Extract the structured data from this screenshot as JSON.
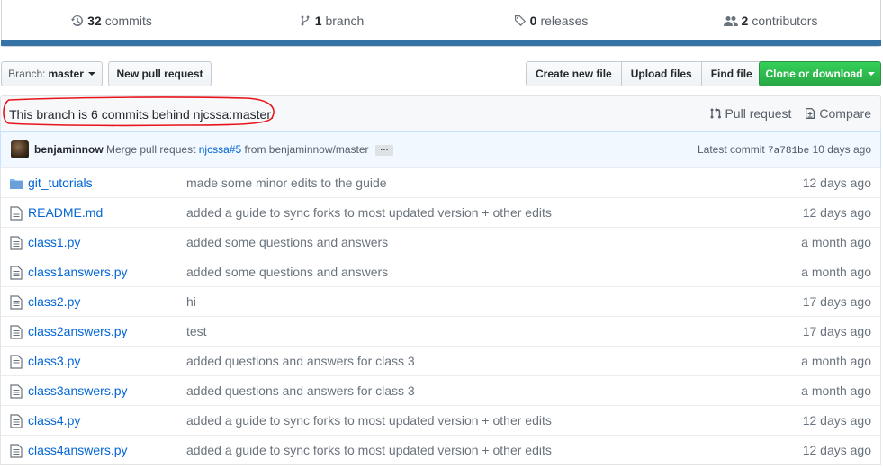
{
  "summary": {
    "commits_count": "32",
    "commits_label": "commits",
    "branches_count": "1",
    "branches_label": "branch",
    "releases_count": "0",
    "releases_label": "releases",
    "contributors_count": "2",
    "contributors_label": "contributors",
    "language_color": "#3572a5"
  },
  "toolbar": {
    "branch_prefix": "Branch:",
    "branch_name": "master",
    "new_pull_request": "New pull request",
    "create_new_file": "Create new file",
    "upload_files": "Upload files",
    "find_file": "Find file",
    "clone_or_download": "Clone or download"
  },
  "branch_info": {
    "message": "This branch is 6 commits behind njcssa:master.",
    "pull_request": "Pull request",
    "compare": "Compare"
  },
  "latest_commit": {
    "author": "benjaminnow",
    "message_prefix": "Merge pull request",
    "pr_link": "njcssa#5",
    "message_suffix": "from benjaminnow/master",
    "ellipsis": "…",
    "label": "Latest commit",
    "sha": "7a781be",
    "age": "10 days ago"
  },
  "files": [
    {
      "name": "git_tutorials",
      "type": "folder",
      "message": "made some minor edits to the guide",
      "age": "12 days ago"
    },
    {
      "name": "README.md",
      "type": "file",
      "message": "added a guide to sync forks to most updated version + other edits",
      "age": "12 days ago"
    },
    {
      "name": "class1.py",
      "type": "file",
      "message": "added some questions and answers",
      "age": "a month ago"
    },
    {
      "name": "class1answers.py",
      "type": "file",
      "message": "added some questions and answers",
      "age": "a month ago"
    },
    {
      "name": "class2.py",
      "type": "file",
      "message": "hi",
      "age": "17 days ago"
    },
    {
      "name": "class2answers.py",
      "type": "file",
      "message": "test",
      "age": "17 days ago"
    },
    {
      "name": "class3.py",
      "type": "file",
      "message": "added questions and answers for class 3",
      "age": "a month ago"
    },
    {
      "name": "class3answers.py",
      "type": "file",
      "message": "added questions and answers for class 3",
      "age": "a month ago"
    },
    {
      "name": "class4.py",
      "type": "file",
      "message": "added a guide to sync forks to most updated version + other edits",
      "age": "12 days ago"
    },
    {
      "name": "class4answers.py",
      "type": "file",
      "message": "added a guide to sync forks to most updated version + other edits",
      "age": "12 days ago"
    }
  ]
}
